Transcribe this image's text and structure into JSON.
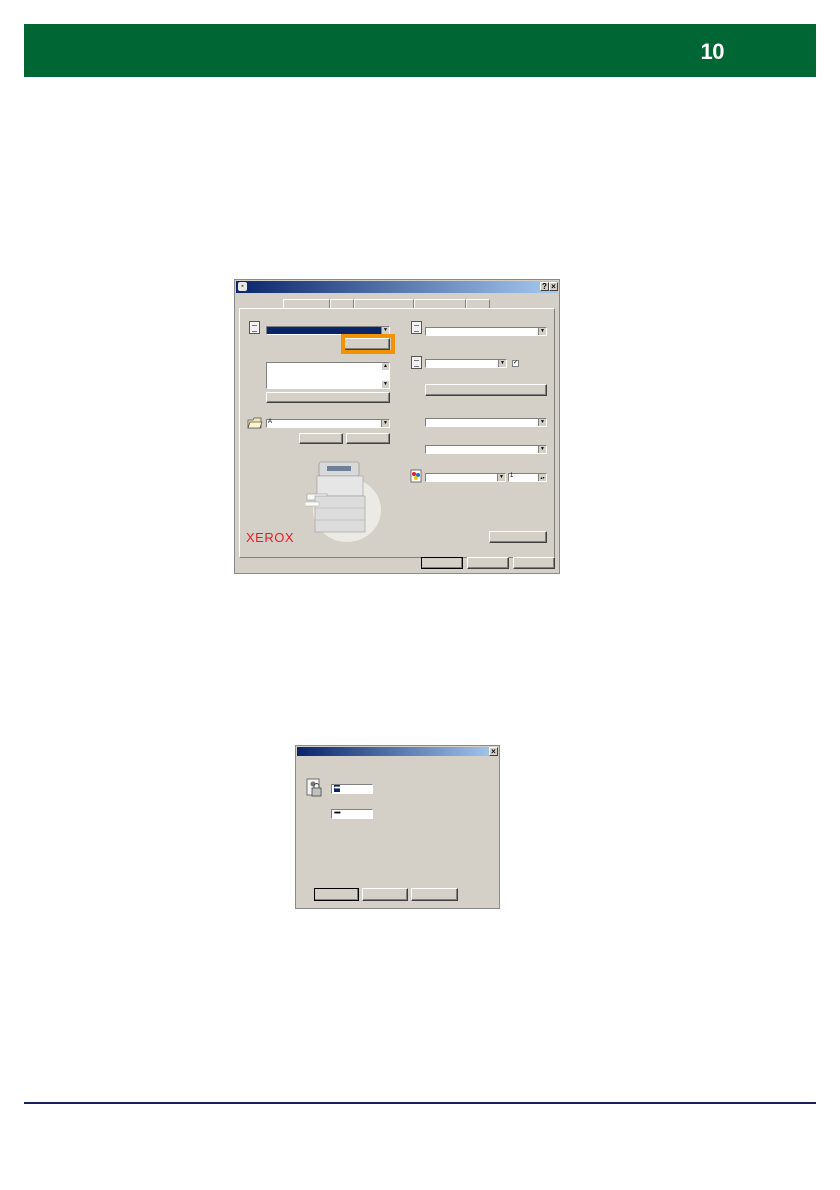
{
  "header": {
    "page_number": "10",
    "color": "#006633"
  },
  "footer": {
    "line_color": "#1a1f5c"
  },
  "print_dialog": {
    "title_buttons": {
      "help": "?",
      "close": "×"
    },
    "title_icon": "printer-icon",
    "logo_text": "XEROX",
    "logo_color": "#e41e26",
    "dropdown_arrow": "▼",
    "font_prefix": "A",
    "copies_value": "1",
    "highlight_color": "#f39200",
    "checkbox_mark": "✓"
  },
  "password_dialog": {
    "close": "×",
    "user_masked": "••••",
    "password_masked": "••••"
  }
}
